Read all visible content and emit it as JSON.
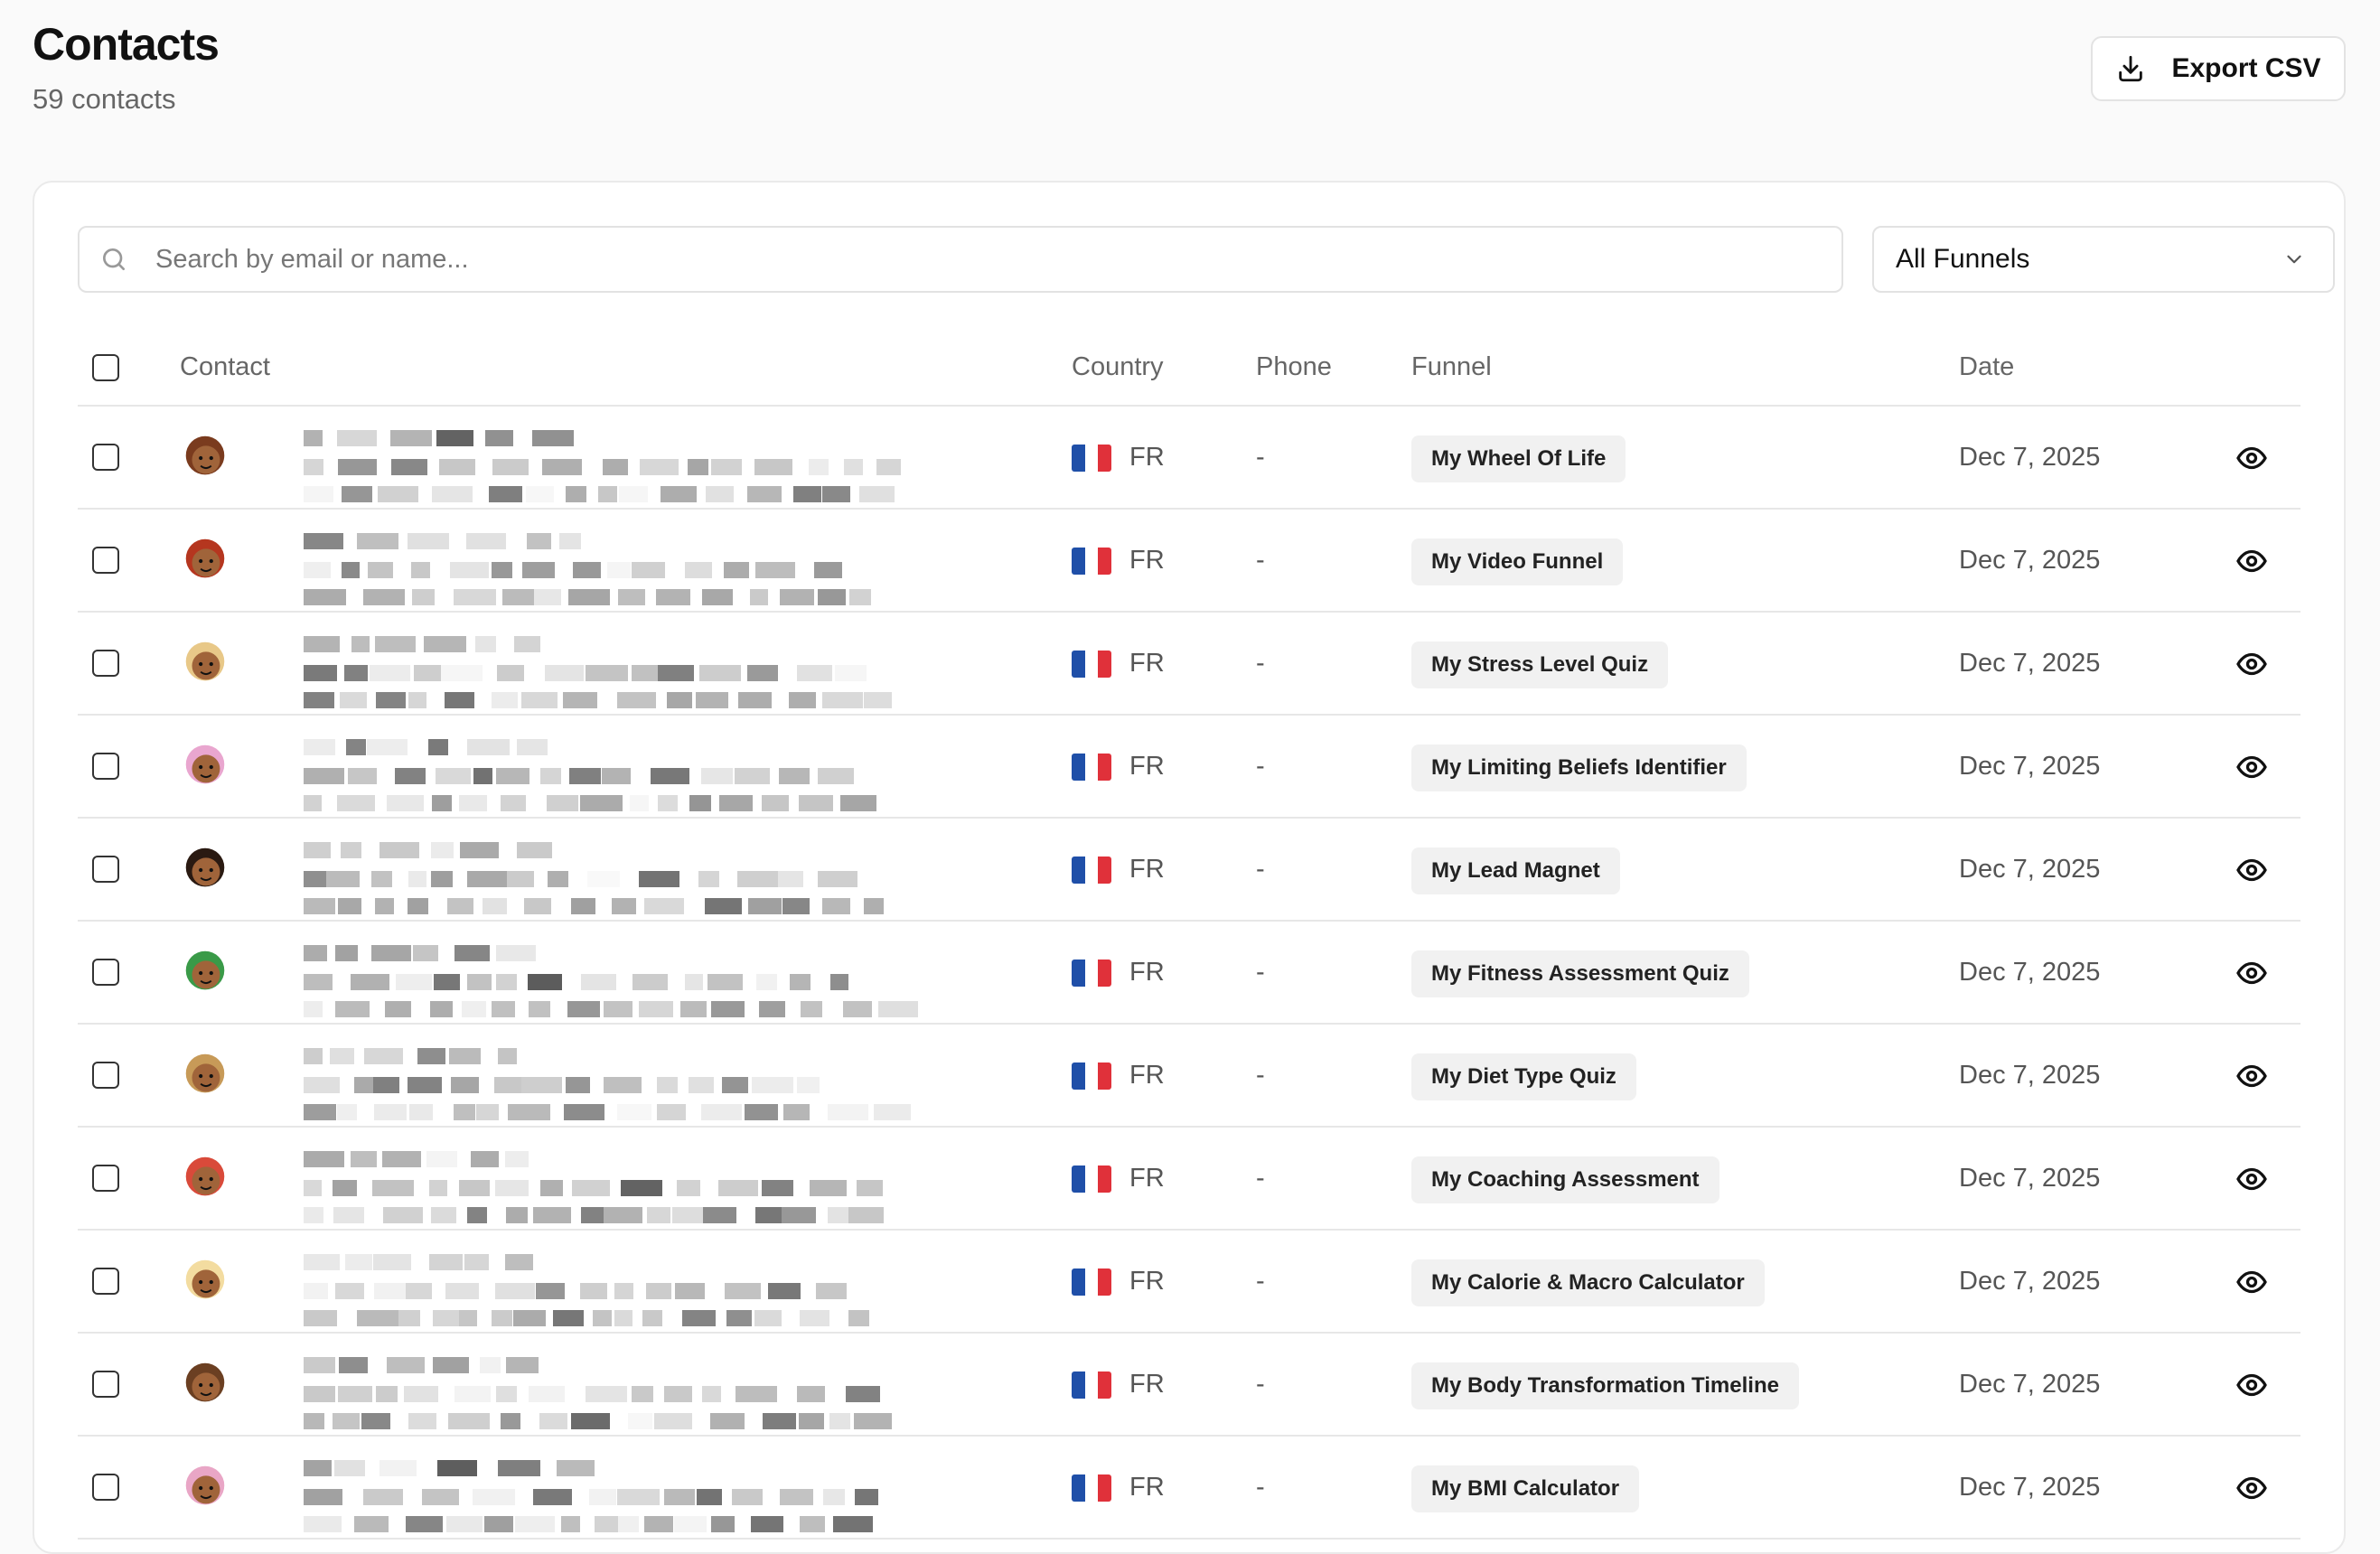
{
  "header": {
    "title": "Contacts",
    "subtitle": "59 contacts",
    "export_label": "Export CSV"
  },
  "toolbar": {
    "search_placeholder": "Search by email or name...",
    "funnel_filter": "All Funnels"
  },
  "table": {
    "columns": {
      "contact": "Contact",
      "country": "Country",
      "phone": "Phone",
      "funnel": "Funnel",
      "date": "Date"
    },
    "rows": [
      {
        "country": "FR",
        "phone": "-",
        "funnel": "My Wheel Of Life",
        "date": "Dec 7, 2025"
      },
      {
        "country": "FR",
        "phone": "-",
        "funnel": "My Video Funnel",
        "date": "Dec 7, 2025"
      },
      {
        "country": "FR",
        "phone": "-",
        "funnel": "My Stress Level Quiz",
        "date": "Dec 7, 2025"
      },
      {
        "country": "FR",
        "phone": "-",
        "funnel": "My Limiting Beliefs Identifier",
        "date": "Dec 7, 2025"
      },
      {
        "country": "FR",
        "phone": "-",
        "funnel": "My Lead Magnet",
        "date": "Dec 7, 2025"
      },
      {
        "country": "FR",
        "phone": "-",
        "funnel": "My Fitness Assessment Quiz",
        "date": "Dec 7, 2025"
      },
      {
        "country": "FR",
        "phone": "-",
        "funnel": "My Diet Type Quiz",
        "date": "Dec 7, 2025"
      },
      {
        "country": "FR",
        "phone": "-",
        "funnel": "My Coaching Assessment",
        "date": "Dec 7, 2025"
      },
      {
        "country": "FR",
        "phone": "-",
        "funnel": "My Calorie & Macro Calculator",
        "date": "Dec 7, 2025"
      },
      {
        "country": "FR",
        "phone": "-",
        "funnel": "My Body Transformation Timeline",
        "date": "Dec 7, 2025"
      },
      {
        "country": "FR",
        "phone": "-",
        "funnel": "My BMI Calculator",
        "date": "Dec 7, 2025"
      }
    ]
  },
  "icons": {
    "export": "download-icon",
    "search": "search-icon",
    "select": "chevron-down-icon",
    "row_action": "eye-icon",
    "country_flag": "france-flag-icon"
  },
  "colors": {
    "flag_blue": "#1f4fa8",
    "flag_white": "#ffffff",
    "flag_red": "#e0313a",
    "avatar_palette": [
      "#7a3b1e",
      "#b5361f",
      "#e8c888",
      "#e9a6cf",
      "#2a1a12",
      "#3a9a48",
      "#c79a58",
      "#d94a3a",
      "#f3dca0",
      "#6b3f22",
      "#e9a6c6"
    ]
  }
}
